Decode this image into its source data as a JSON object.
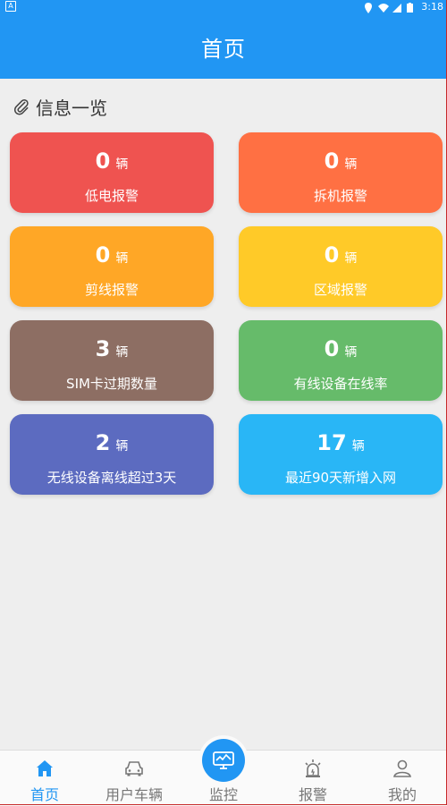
{
  "status_bar": {
    "time": "3:18"
  },
  "header": {
    "title": "首页"
  },
  "section": {
    "title": "信息一览"
  },
  "unit": "辆",
  "cards": [
    {
      "value": "0",
      "label": "低电报警",
      "color": "#EF5350"
    },
    {
      "value": "0",
      "label": "拆机报警",
      "color": "#FF7043"
    },
    {
      "value": "0",
      "label": "剪线报警",
      "color": "#FFA726"
    },
    {
      "value": "0",
      "label": "区域报警",
      "color": "#FFCA28"
    },
    {
      "value": "3",
      "label": "SIM卡过期数量",
      "color": "#8D6E63"
    },
    {
      "value": "0",
      "label": "有线设备在线率",
      "color": "#66BB6A"
    },
    {
      "value": "2",
      "label": "无线设备离线超过3天",
      "color": "#5C6BC0"
    },
    {
      "value": "17",
      "label": "最近90天新增入网",
      "color": "#29B6F6"
    }
  ],
  "nav": {
    "home": "首页",
    "vehicles": "用户车辆",
    "monitor": "监控",
    "alarm": "报警",
    "mine": "我的"
  },
  "colors": {
    "primary": "#2196F3"
  }
}
